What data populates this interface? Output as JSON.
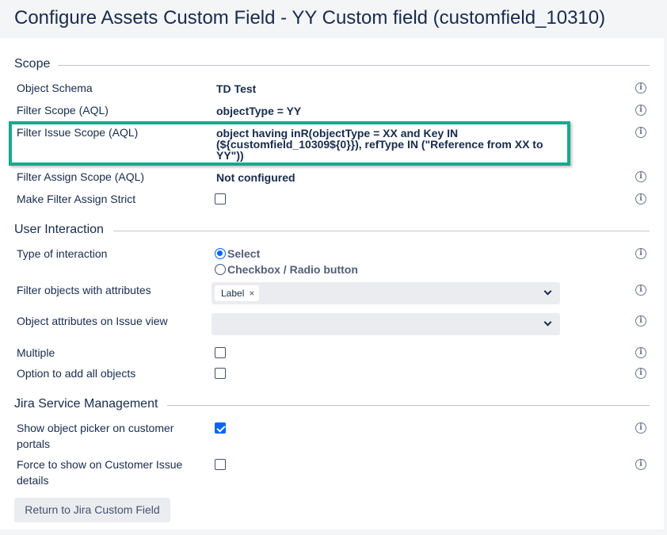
{
  "page": {
    "title": "Configure Assets Custom Field - YY Custom field (customfield_10310)"
  },
  "scope": {
    "title": "Scope",
    "object_schema": {
      "label": "Object Schema",
      "value": "TD Test"
    },
    "filter_scope": {
      "label": "Filter Scope (AQL)",
      "value": "objectType = YY"
    },
    "filter_issue_scope": {
      "label": "Filter Issue Scope (AQL)",
      "value_line1": "object having inR(objectType = XX and Key IN",
      "value_line2": "(${customfield_10309${0}}), refType IN (\"Reference from XX to",
      "value_line3": "YY\"))"
    },
    "filter_assign_scope": {
      "label": "Filter Assign Scope (AQL)",
      "value": "Not configured"
    },
    "make_filter_assign_strict": {
      "label": "Make Filter Assign Strict",
      "checked": false
    }
  },
  "user_interaction": {
    "title": "User Interaction",
    "type_of_interaction": {
      "label": "Type of interaction",
      "options": [
        "Select",
        "Checkbox / Radio button"
      ],
      "selected": "Select"
    },
    "filter_objects": {
      "label": "Filter objects with attributes",
      "tags": [
        "Label"
      ],
      "remove_glyph": "×"
    },
    "object_attributes": {
      "label": "Object attributes on Issue view"
    },
    "multiple": {
      "label": "Multiple",
      "checked": false
    },
    "add_all_objects": {
      "label": "Option to add all objects",
      "checked": false
    }
  },
  "jsm": {
    "title": "Jira Service Management",
    "show_object_picker": {
      "label_line1": "Show object picker on customer",
      "label_line2": "portals",
      "checked": true
    },
    "force_show": {
      "label_line1": "Force to show on Customer Issue",
      "label_line2": "details",
      "checked": false
    }
  },
  "actions": {
    "return_button": "Return to Jira Custom Field"
  },
  "icons": {
    "info_glyph": "i",
    "info_icon_name": "info-icon"
  },
  "colors": {
    "accent": "#0065ff",
    "highlight": "#1aa88e",
    "text": "#172b4d"
  }
}
